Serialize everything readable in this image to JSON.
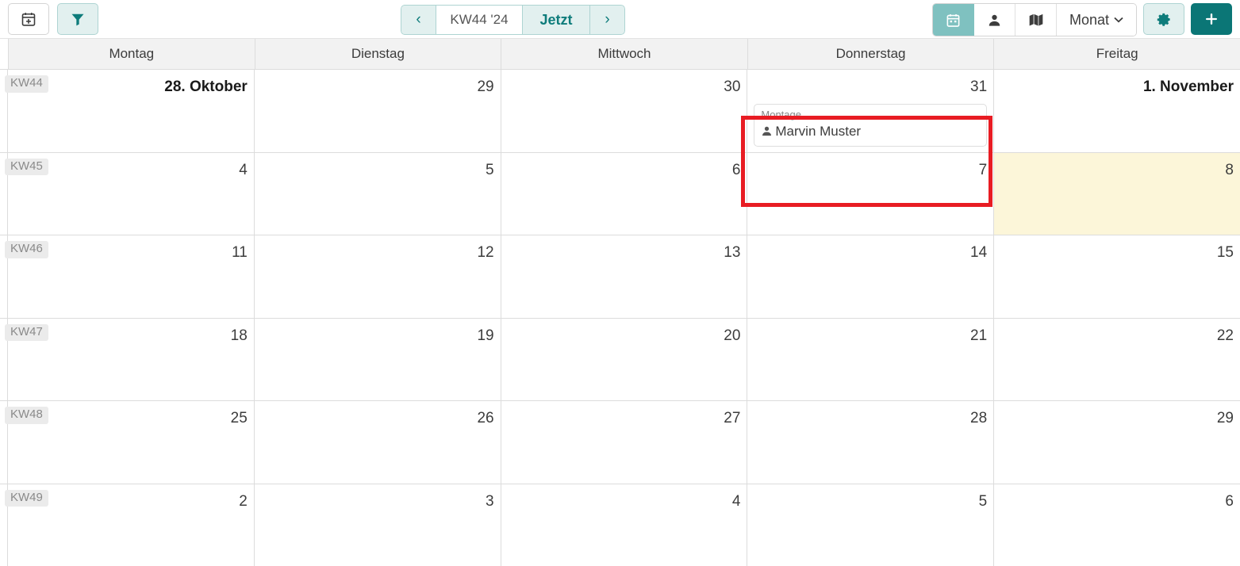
{
  "toolbar": {
    "new_event_button": "calendar-plus-icon",
    "filter_button": "filter-icon",
    "prev_label": "‹",
    "period_label": "KW44 '24",
    "now_label": "Jetzt",
    "next_label": "›",
    "view_calendar": "calendar-icon",
    "view_person": "person-icon",
    "view_map": "map-icon",
    "view_mode": "Monat",
    "view_mode_chevron": "⌄",
    "settings_button": "gear-icon",
    "add_button": "+"
  },
  "calendar": {
    "day_headers": [
      "Montag",
      "Dienstag",
      "Mittwoch",
      "Donnerstag",
      "Freitag"
    ],
    "weeks": [
      {
        "week_label": "KW44",
        "days": [
          {
            "number": "28. Oktober",
            "bold": true,
            "highlight": false,
            "events": []
          },
          {
            "number": "29",
            "bold": false,
            "highlight": false,
            "events": []
          },
          {
            "number": "30",
            "bold": false,
            "highlight": false,
            "events": []
          },
          {
            "number": "31",
            "bold": false,
            "highlight": false,
            "events": [
              {
                "subtitle": "Montage",
                "name": "Marvin Muster",
                "icon": "person-icon"
              }
            ]
          },
          {
            "number": "1. November",
            "bold": true,
            "highlight": false,
            "events": []
          }
        ]
      },
      {
        "week_label": "KW45",
        "days": [
          {
            "number": "4",
            "bold": false,
            "highlight": false,
            "events": []
          },
          {
            "number": "5",
            "bold": false,
            "highlight": false,
            "events": []
          },
          {
            "number": "6",
            "bold": false,
            "highlight": false,
            "events": []
          },
          {
            "number": "7",
            "bold": false,
            "highlight": false,
            "events": []
          },
          {
            "number": "8",
            "bold": false,
            "highlight": true,
            "events": []
          }
        ]
      },
      {
        "week_label": "KW46",
        "days": [
          {
            "number": "11",
            "bold": false,
            "highlight": false,
            "events": []
          },
          {
            "number": "12",
            "bold": false,
            "highlight": false,
            "events": []
          },
          {
            "number": "13",
            "bold": false,
            "highlight": false,
            "events": []
          },
          {
            "number": "14",
            "bold": false,
            "highlight": false,
            "events": []
          },
          {
            "number": "15",
            "bold": false,
            "highlight": false,
            "events": []
          }
        ]
      },
      {
        "week_label": "KW47",
        "days": [
          {
            "number": "18",
            "bold": false,
            "highlight": false,
            "events": []
          },
          {
            "number": "19",
            "bold": false,
            "highlight": false,
            "events": []
          },
          {
            "number": "20",
            "bold": false,
            "highlight": false,
            "events": []
          },
          {
            "number": "21",
            "bold": false,
            "highlight": false,
            "events": []
          },
          {
            "number": "22",
            "bold": false,
            "highlight": false,
            "events": []
          }
        ]
      },
      {
        "week_label": "KW48",
        "days": [
          {
            "number": "25",
            "bold": false,
            "highlight": false,
            "events": []
          },
          {
            "number": "26",
            "bold": false,
            "highlight": false,
            "events": []
          },
          {
            "number": "27",
            "bold": false,
            "highlight": false,
            "events": []
          },
          {
            "number": "28",
            "bold": false,
            "highlight": false,
            "events": []
          },
          {
            "number": "29",
            "bold": false,
            "highlight": false,
            "events": []
          }
        ]
      },
      {
        "week_label": "KW49",
        "days": [
          {
            "number": "2",
            "bold": false,
            "highlight": false,
            "events": []
          },
          {
            "number": "3",
            "bold": false,
            "highlight": false,
            "events": []
          },
          {
            "number": "4",
            "bold": false,
            "highlight": false,
            "events": []
          },
          {
            "number": "5",
            "bold": false,
            "highlight": false,
            "events": []
          },
          {
            "number": "6",
            "bold": false,
            "highlight": false,
            "events": []
          }
        ]
      }
    ]
  },
  "annotation": {
    "highlight_box_color": "#e81c23"
  },
  "colors": {
    "accent_teal": "#0b7676",
    "accent_teal_light": "#e2f0ef",
    "accent_teal_muted": "#7fc1c0",
    "highlight_yellow": "#fcf6d9",
    "grid_border": "#dcdcdc",
    "header_bg": "#f2f2f2"
  }
}
